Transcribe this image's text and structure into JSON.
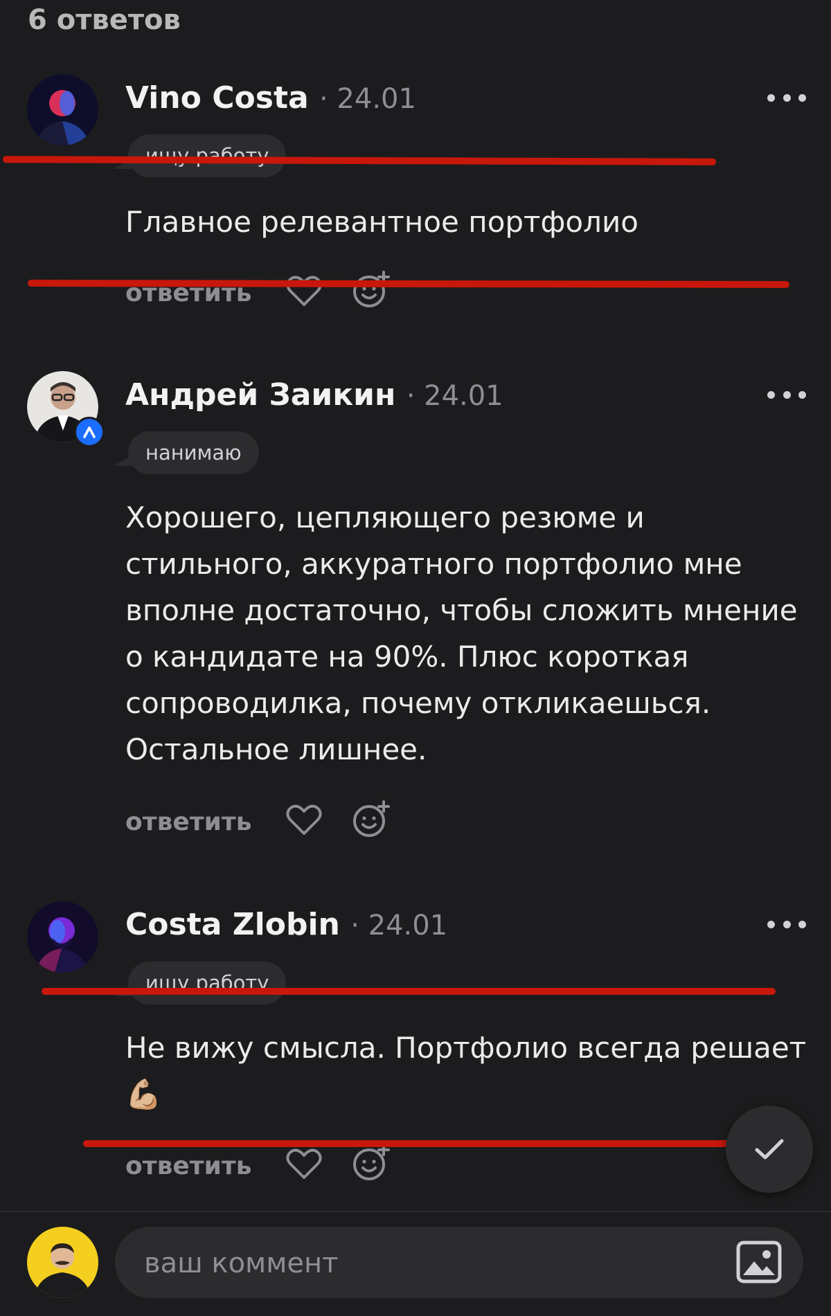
{
  "header": {
    "replies_count": "6 ответов"
  },
  "comments": [
    {
      "author": "Vino Costa",
      "date": "· 24.01",
      "badge": "ищу работу",
      "text": "Главное релевантное портфолио",
      "reply_label": "ответить"
    },
    {
      "author": "Андрей Заикин",
      "date": "· 24.01",
      "badge": "нанимаю",
      "text": "Хорошего, цепляющего резюме и стильного, аккуратного портфолио мне вполне достаточно, чтобы сложить мнение о кандидате на 90%. Плюс короткая сопроводилка, почему откликаешься. Остальное лишнее.",
      "reply_label": "ответить"
    },
    {
      "author": "Costa Zlobin",
      "date": "· 24.01",
      "badge": "ищу работу",
      "text": "Не вижу смысла. Портфолио всегда решает 💪🏼",
      "reply_label": "ответить"
    }
  ],
  "composer": {
    "placeholder": "ваш коммент"
  },
  "colors": {
    "background": "#1c1c1e",
    "accent_red": "#c8170b",
    "verified_blue": "#1a6dff",
    "my_avatar_bg": "#f4cf1f"
  }
}
